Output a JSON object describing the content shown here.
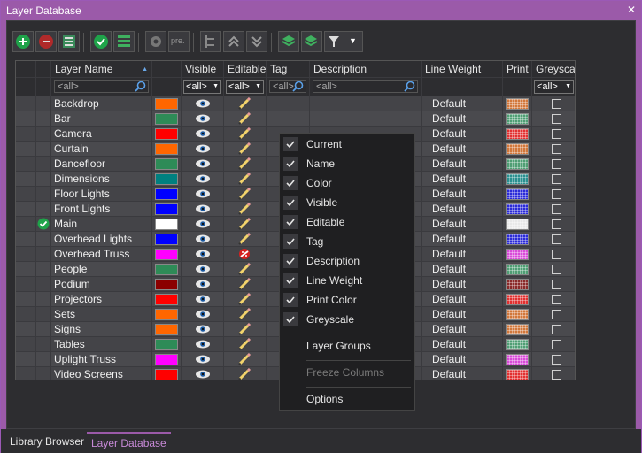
{
  "window": {
    "title": "Layer Database",
    "close_glyph": "✕"
  },
  "toolbar": {
    "buttons": [
      {
        "name": "add-layer-button",
        "icon": "plus-circle-icon"
      },
      {
        "name": "remove-layer-button",
        "icon": "minus-circle-icon"
      },
      {
        "name": "layer-list-button",
        "icon": "list-grid-icon"
      },
      {
        "name": "check-button",
        "icon": "check-circle-icon"
      },
      {
        "name": "stack-button",
        "icon": "stack-icon"
      },
      {
        "name": "settings-button",
        "icon": "gear-icon"
      },
      {
        "name": "prefix-button",
        "icon": "prefix-icon",
        "label": "pre."
      },
      {
        "name": "hierarchy-button",
        "icon": "tree-icon"
      },
      {
        "name": "move-up-button",
        "icon": "double-chevron-up-icon"
      },
      {
        "name": "move-down-button",
        "icon": "double-chevron-down-icon"
      },
      {
        "name": "layers-button",
        "icon": "layers-icon"
      },
      {
        "name": "add-group-button",
        "icon": "layers-plus-icon"
      },
      {
        "name": "filter-button",
        "icon": "filter-icon"
      }
    ]
  },
  "grid": {
    "columns": [
      "",
      "",
      "Layer Name",
      "",
      "Visible",
      "Editable",
      "Tag",
      "Description",
      "Line Weight",
      "Print",
      "Greyscale"
    ],
    "filters": {
      "name": "<all>",
      "visible": "<all>",
      "editable": "<all>",
      "tag": "<all>",
      "description": "<all>",
      "greyscale": "<all>"
    },
    "rows": [
      {
        "name": "Backdrop",
        "color": "#ff6600",
        "line_weight": "Default",
        "print": "#d2773a",
        "current": false,
        "editable": "pencil"
      },
      {
        "name": "Bar",
        "color": "#2e8b57",
        "line_weight": "Default",
        "print": "#4f9e74",
        "current": false,
        "editable": "pencil"
      },
      {
        "name": "Camera",
        "color": "#ff0000",
        "line_weight": "Default",
        "print": "#e23030",
        "current": false,
        "editable": "pencil"
      },
      {
        "name": "Curtain",
        "color": "#ff6600",
        "line_weight": "Default",
        "print": "#d2773a",
        "current": false,
        "editable": "pencil"
      },
      {
        "name": "Dancefloor",
        "color": "#2e8b57",
        "line_weight": "Default",
        "print": "#4f9e74",
        "current": false,
        "editable": "pencil"
      },
      {
        "name": "Dimensions",
        "color": "#008080",
        "line_weight": "Default",
        "print": "#2a9090",
        "current": false,
        "editable": "pencil"
      },
      {
        "name": "Floor Lights",
        "color": "#0000ff",
        "line_weight": "Default",
        "print": "#2a2ad8",
        "current": false,
        "editable": "pencil"
      },
      {
        "name": "Front Lights",
        "color": "#0000ff",
        "line_weight": "Default",
        "print": "#2a2ad8",
        "current": false,
        "editable": "pencil"
      },
      {
        "name": "Main",
        "color": "#ffffff",
        "line_weight": "Default",
        "print": "#e8e8e8",
        "current": true,
        "editable": "pencil"
      },
      {
        "name": "Overhead Lights",
        "color": "#0000ff",
        "line_weight": "Default",
        "print": "#2a2ad8",
        "current": false,
        "editable": "pencil"
      },
      {
        "name": "Overhead Truss",
        "color": "#ff00ff",
        "line_weight": "Default",
        "print": "#d84ad8",
        "current": false,
        "editable": "locked"
      },
      {
        "name": "People",
        "color": "#2e8b57",
        "line_weight": "Default",
        "print": "#4f9e74",
        "current": false,
        "editable": "pencil"
      },
      {
        "name": "Podium",
        "color": "#8b0000",
        "line_weight": "Default",
        "print": "#8a2a2a",
        "current": false,
        "editable": "pencil"
      },
      {
        "name": "Projectors",
        "color": "#ff0000",
        "line_weight": "Default",
        "print": "#e23030",
        "current": false,
        "editable": "pencil"
      },
      {
        "name": "Sets",
        "color": "#ff6600",
        "line_weight": "Default",
        "print": "#d2773a",
        "current": false,
        "editable": "pencil"
      },
      {
        "name": "Signs",
        "color": "#ff6600",
        "line_weight": "Default",
        "print": "#d2773a",
        "current": false,
        "editable": "pencil"
      },
      {
        "name": "Tables",
        "color": "#2e8b57",
        "line_weight": "Default",
        "print": "#4f9e74",
        "current": false,
        "editable": "pencil"
      },
      {
        "name": "Uplight Truss",
        "color": "#ff00ff",
        "line_weight": "Default",
        "print": "#d84ad8",
        "current": false,
        "editable": "pencil"
      },
      {
        "name": "Video Screens",
        "color": "#ff0000",
        "line_weight": "Default",
        "print": "#e23030",
        "current": false,
        "editable": "pencil"
      }
    ]
  },
  "context_menu": {
    "items": [
      {
        "label": "Current",
        "checked": true
      },
      {
        "label": "Name",
        "checked": true
      },
      {
        "label": "Color",
        "checked": true
      },
      {
        "label": "Visible",
        "checked": true
      },
      {
        "label": "Editable",
        "checked": true
      },
      {
        "label": "Tag",
        "checked": true
      },
      {
        "label": "Description",
        "checked": true
      },
      {
        "label": "Line Weight",
        "checked": true
      },
      {
        "label": "Print Color",
        "checked": true
      },
      {
        "label": "Greyscale",
        "checked": true
      }
    ],
    "layer_groups": "Layer Groups",
    "freeze_columns": "Freeze Columns",
    "options": "Options"
  },
  "tabs": [
    {
      "label": "Library Browser",
      "active": false
    },
    {
      "label": "Layer Database",
      "active": true
    }
  ],
  "colors": {
    "accent": "#9b5aa9"
  }
}
